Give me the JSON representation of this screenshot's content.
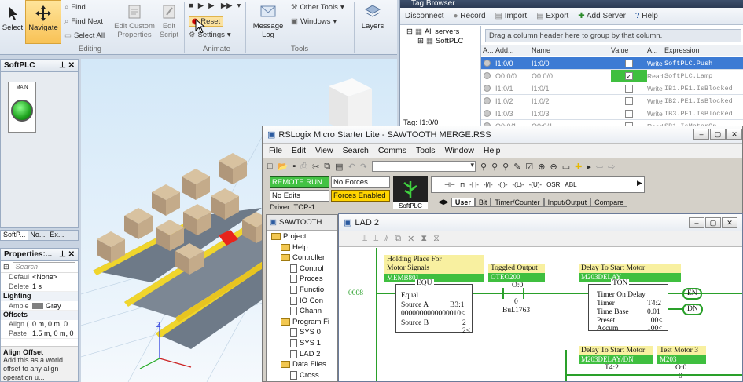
{
  "ribbon": {
    "select": "Select",
    "navigate": "Navigate",
    "find": "Find",
    "find_next": "Find Next",
    "select_all": "Select All",
    "edit_custom_properties": "Edit Custom Properties",
    "edit_script": "Edit Script",
    "editing_group": "Editing",
    "reset": "Reset",
    "settings": "Settings",
    "animate_group": "Animate",
    "message_log": "Message Log",
    "other_tools": "Other Tools",
    "windows": "Windows",
    "tools_group": "Tools",
    "layers": "Layers"
  },
  "softplc_panel": {
    "title": "SoftPLC",
    "main_label": "MAIN"
  },
  "tabs": {
    "t1": "SoftP...",
    "t2": "No...",
    "t3": "Ex..."
  },
  "properties": {
    "title": "Properties:...",
    "rows": [
      {
        "name": "Defaul",
        "value": "<None>"
      },
      {
        "name": "Delete",
        "value": "1 s"
      }
    ],
    "lighting": "Lighting",
    "ambient": {
      "name": "Ambie",
      "value": "Gray"
    },
    "offsets": "Offsets",
    "align": {
      "name": "Align (",
      "value": "0 m, 0 m, 0"
    },
    "paste": {
      "name": "Paste",
      "value": "1.5 m, 0 m, 0"
    },
    "desc_title": "Align Offset",
    "desc_text": "Add this as a world offset to any align operation u..."
  },
  "tag_browser": {
    "title": "Tag Browser",
    "toolbar": [
      "Disconnect",
      "Record",
      "Import",
      "Export",
      "Add Server",
      "Help"
    ],
    "tree_all": "All servers",
    "tree_softplc": "SoftPLC",
    "group_hint": "Drag a column header here to group by that column.",
    "columns": [
      "A...",
      "Add...",
      "Name",
      "Value",
      "A...",
      "Expression"
    ],
    "rows": [
      {
        "addr": "I1:0/0",
        "name": "I1:0/0",
        "checked": false,
        "access": "Write",
        "expr": "SoftPLC.Push"
      },
      {
        "addr": "O0:0/0",
        "name": "O0:0/0",
        "checked": true,
        "access": "Read",
        "expr": "SoftPLC.Lamp"
      },
      {
        "addr": "I1:0/1",
        "name": "I1:0/1",
        "checked": false,
        "access": "Write",
        "expr": "IB1.PE1.IsBlocked"
      },
      {
        "addr": "I1:0/2",
        "name": "I1:0/2",
        "checked": false,
        "access": "Write",
        "expr": "IB2.PE1.IsBlocked"
      },
      {
        "addr": "I1:0/3",
        "name": "I1:0/3",
        "checked": false,
        "access": "Write",
        "expr": "IB3.PE1.IsBlocked"
      },
      {
        "addr": "O0:0/1",
        "name": "O0:0/1",
        "checked": false,
        "access": "Read",
        "expr": "SB1.IsMotorOn"
      }
    ],
    "footer": "Tag: I1:0/0"
  },
  "rslogix": {
    "title": "RSLogix Micro Starter Lite - SAWTOOTH MERGE.RSS",
    "menu": [
      "File",
      "Edit",
      "View",
      "Search",
      "Comms",
      "Tools",
      "Window",
      "Help"
    ],
    "mode": "REMOTE RUN",
    "forces": "No Forces",
    "edits": "No Edits",
    "forces_enabled": "Forces Enabled",
    "driver": "Driver: TCP-1",
    "softplc": "SoftPLC",
    "instr_tabs": [
      "User",
      "Bit",
      "Timer/Counter",
      "Input/Output",
      "Compare"
    ],
    "project_title": "SAWTOOTH ...",
    "tree": [
      "Project",
      "Help",
      "Controller",
      "Control",
      "Proces",
      "Functio",
      "IO Con",
      "Chann",
      "Program Fi",
      "SYS 0",
      "SYS 1",
      "LAD 2",
      "Data Files",
      "Cross"
    ],
    "lad_title": "LAD 2"
  },
  "ladder": {
    "rung": "0008",
    "d1": "Holding Place For",
    "d2": "Motor Signals",
    "a1": "MEMB801",
    "equ": "EQU",
    "equal": "Equal",
    "srca": "Source A",
    "srca_v": "B3:1",
    "srca_val": "0000000000000010<",
    "srcb": "Source B",
    "srcb_v": "2",
    "srcb_val": "2<",
    "d3": "Toggled Output",
    "a3": "OTEO200",
    "o_addr": "O:0",
    "o_bit": "0",
    "o_name": "Bul.1763",
    "d4": "Delay To Start Motor",
    "a4": "M203DELAY",
    "ton": "TON",
    "ton_title": "Timer On Delay",
    "timer": "Timer",
    "timer_v": "T4:2",
    "tb": "Time Base",
    "tb_v": "0.01",
    "preset": "Preset",
    "preset_v": "100<",
    "accum": "Accum",
    "accum_v": "100<",
    "en": "EN",
    "dn": "DN",
    "d5": "Delay To Start Motor",
    "a5": "M203DELAY/DN",
    "t42": "T4:2",
    "d6": "Test Motor 3",
    "a6": "M203",
    "o2_addr": "O:0",
    "o2_bit": "0"
  },
  "colors": {
    "accent": "#3fbf3f",
    "yellow": "#ffd400"
  }
}
